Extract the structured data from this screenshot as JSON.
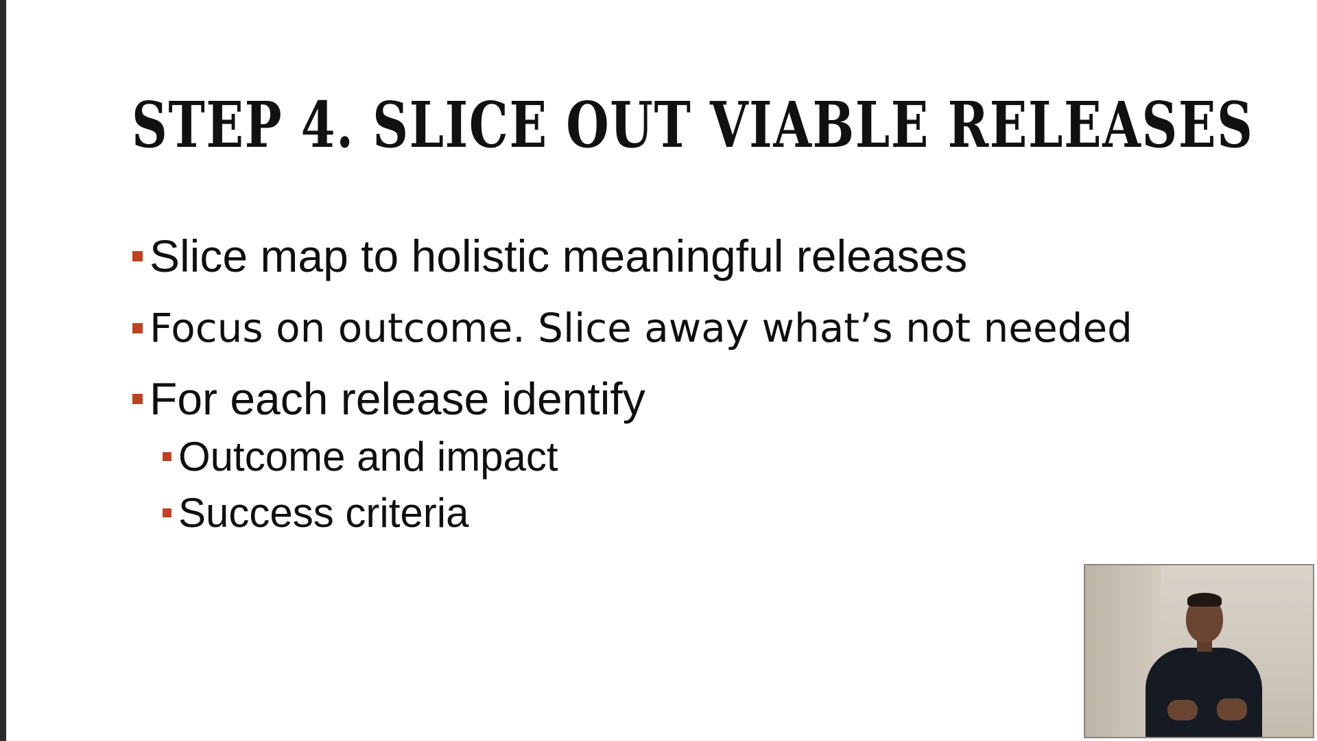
{
  "slide": {
    "title": "STEP 4. SLICE OUT VIABLE RELEASES",
    "bullets": [
      {
        "text": "Slice map to holistic meaningful releases"
      },
      {
        "text": "Focus on outcome. Slice away what’s not needed"
      },
      {
        "text": "For each release identify",
        "sub_bullets": [
          {
            "text": "Outcome and impact"
          },
          {
            "text": "Success criteria"
          }
        ]
      }
    ]
  },
  "colors": {
    "bullet_marker": "#c0401f",
    "title_text": "#111111",
    "body_text": "#0f0f0f",
    "background": "#ffffff"
  },
  "webcam_overlay": {
    "visible": true,
    "content": "presenter"
  }
}
